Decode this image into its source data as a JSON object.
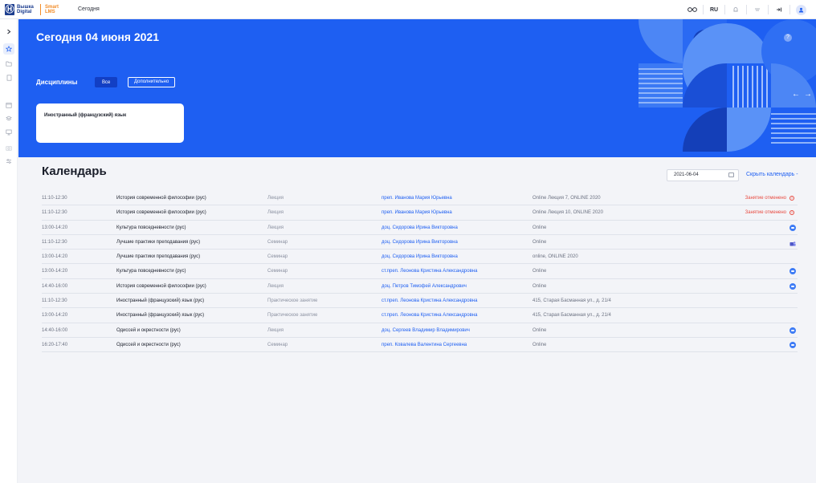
{
  "topbar": {
    "logo_text1": "Вышка Digital",
    "logo_text2": "Smart LMS",
    "nav_today": "Сегодня",
    "lang": "RU",
    "icons": [
      "glasses-icon",
      "lang-switch",
      "bell-icon",
      "filter-icon",
      "logout-icon",
      "user-avatar-icon"
    ]
  },
  "sidebar": {
    "icons": [
      "chevron-right-icon",
      "star-icon",
      "folder-icon",
      "document-icon",
      "calendar-icon",
      "layers-icon",
      "monitor-icon",
      "camera-icon",
      "sliders-icon"
    ]
  },
  "banner": {
    "title": "Сегодня 04 июня 2021",
    "disciplines_label": "Дисциплины",
    "filter_all": "Все",
    "filter_more": "Дополнительно",
    "card_title": "Иностранный (французский) язык",
    "help": "?",
    "arrow_left": "←",
    "arrow_right": "→"
  },
  "calendar": {
    "title": "Календарь",
    "date_value": "2021-06-04",
    "hide_link": "Скрыть календарь -",
    "rows": [
      {
        "time": "11:10-12:30",
        "subject": "История современной философии (рус)",
        "type": "Лекция",
        "teacher": "преп. Иванова Мария Юрьевна",
        "place": "Online Лекция 7, ONLINE 2020",
        "status": "Занятие отменено",
        "link": ""
      },
      {
        "time": "11:10-12:30",
        "subject": "История современной философии (рус)",
        "type": "Лекция",
        "teacher": "преп. Иванова Мария Юрьевна",
        "place": "Online Лекция 10, ONLINE 2020",
        "status": "Занятие отменено",
        "link": ""
      },
      {
        "time": "13:00-14:20",
        "subject": "Культура повседневности (рус)",
        "type": "Лекция",
        "teacher": "доц. Сидорова Ирина Викторовна",
        "place": "Online",
        "status": "",
        "link": "zoom"
      },
      {
        "time": "11:10-12:30",
        "subject": "Лучшие практики преподавания (рус)",
        "type": "Семинар",
        "teacher": "доц. Сидорова Ирина Викторовна",
        "place": "Online",
        "status": "",
        "link": "teams"
      },
      {
        "time": "13:00-14:20",
        "subject": "Лучшие практики преподавания (рус)",
        "type": "Семинар",
        "teacher": "доц. Сидорова Ирина Викторовна",
        "place": "online, ONLINE 2020",
        "status": "",
        "link": ""
      },
      {
        "time": "13:00-14:20",
        "subject": "Культура повседневности (рус)",
        "type": "Семинар",
        "teacher": "ст.преп. Леонова Кристина Александровна",
        "place": "Online",
        "status": "",
        "link": "zoom"
      },
      {
        "time": "14:40-16:00",
        "subject": "История современной философии (рус)",
        "type": "Лекция",
        "teacher": "доц. Петров Тимофей Александрович",
        "place": "Online",
        "status": "",
        "link": "zoom"
      },
      {
        "time": "11:10-12:30",
        "subject": "Иностранный (французский) язык (рус)",
        "type": "Практическое занятие",
        "teacher": "ст.преп. Леонова Кристина Александровна",
        "place": "415, Старая Басманная ул., д. 21/4",
        "status": "",
        "link": ""
      },
      {
        "time": "13:00-14:20",
        "subject": "Иностранный (французский) язык (рус)",
        "type": "Практическое занятие",
        "teacher": "ст.преп. Леонова Кристина Александровна",
        "place": "415, Старая Басманная ул., д. 21/4",
        "status": "",
        "link": ""
      },
      {
        "time": "14:40-16:00",
        "subject": "Одиссей и окрестности (рус)",
        "type": "Лекция",
        "teacher": "доц. Сергеев Владимир Владимирович",
        "place": "Online",
        "status": "",
        "link": "zoom"
      },
      {
        "time": "16:20-17:40",
        "subject": "Одиссей и окрестности (рус)",
        "type": "Семинар",
        "teacher": "преп. Ковалева Валентина Сергеевна",
        "place": "Online",
        "status": "",
        "link": "zoom"
      }
    ]
  },
  "colors": {
    "accent": "#1e5ff2",
    "cancelled": "#e8493f",
    "logo_blue": "#1b3c8e",
    "logo_orange": "#f28c28"
  }
}
